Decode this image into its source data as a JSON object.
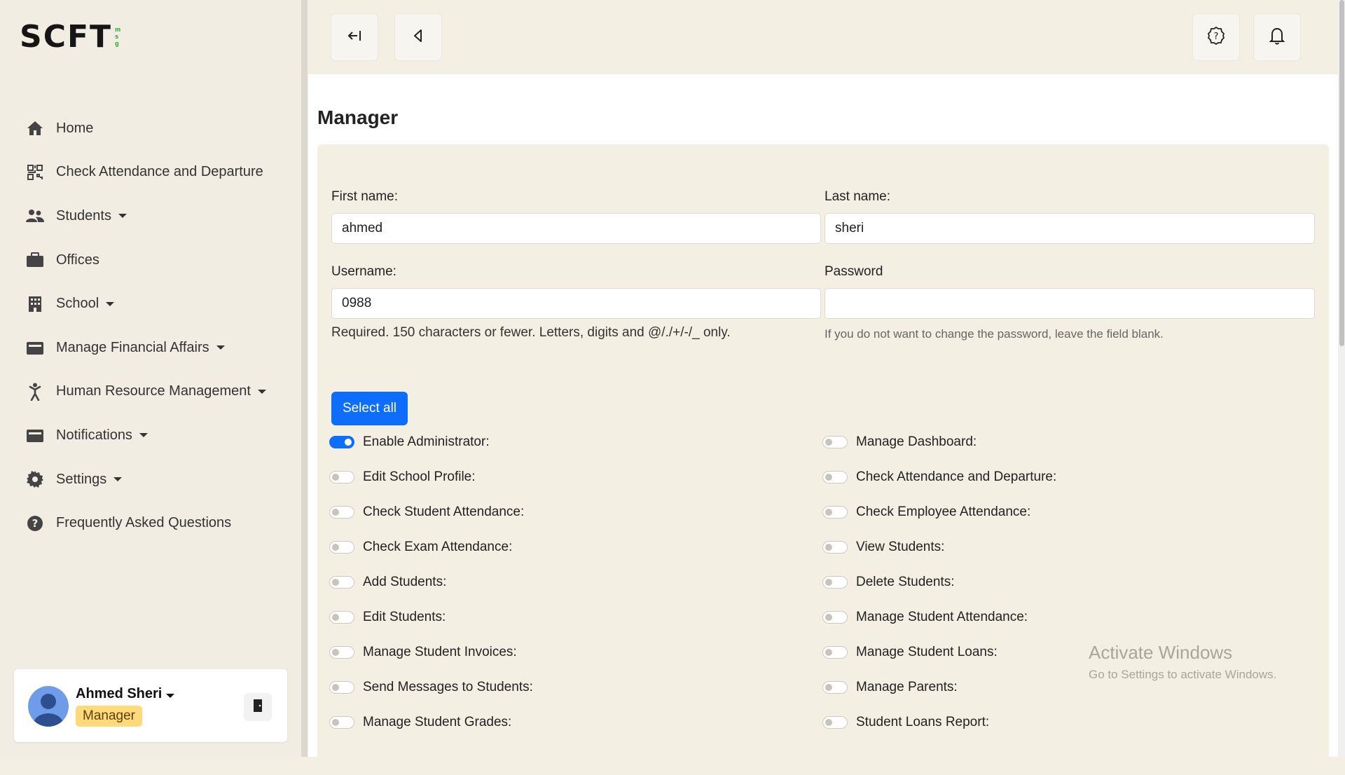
{
  "brand": {
    "logo_text": "SCFT",
    "logo_sub": [
      "m",
      "s",
      "g"
    ]
  },
  "sidebar": {
    "items": [
      {
        "label": "Home",
        "icon": "home-icon",
        "dropdown": false
      },
      {
        "label": "Check Attendance and Departure",
        "icon": "qr-code-icon",
        "dropdown": false
      },
      {
        "label": "Students",
        "icon": "users-icon",
        "dropdown": true
      },
      {
        "label": "Offices",
        "icon": "briefcase-icon",
        "dropdown": false
      },
      {
        "label": "School",
        "icon": "building-icon",
        "dropdown": true
      },
      {
        "label": "Manage Financial Affairs",
        "icon": "wallet-icon",
        "dropdown": true
      },
      {
        "label": "Human Resource Management",
        "icon": "person-icon",
        "dropdown": true
      },
      {
        "label": "Notifications",
        "icon": "inbox-icon",
        "dropdown": true
      },
      {
        "label": "Settings",
        "icon": "gear-icon",
        "dropdown": true
      },
      {
        "label": "Frequently Asked Questions",
        "icon": "question-circle-icon",
        "dropdown": false
      }
    ]
  },
  "user": {
    "name": "Ahmed Sheri",
    "role": "Manager"
  },
  "topbar": {
    "buttons": [
      "collapse-sidebar-icon",
      "back-icon",
      "help-icon",
      "bell-icon"
    ]
  },
  "page": {
    "title": "Manager"
  },
  "form": {
    "first_name_label": "First name:",
    "first_name_value": "ahmed",
    "last_name_label": "Last name:",
    "last_name_value": "sheri",
    "username_label": "Username:",
    "username_value": "0988",
    "username_help": "Required. 150 characters or fewer. Letters, digits and @/./+/-/_ only.",
    "password_label": "Password",
    "password_value": "",
    "password_help": "If you do not want to change the password, leave the field blank.",
    "select_all_label": "Select all"
  },
  "permissions_left": [
    {
      "label": "Enable Administrator:",
      "on": true
    },
    {
      "label": "Edit School Profile:",
      "on": false
    },
    {
      "label": "Check Student Attendance:",
      "on": false
    },
    {
      "label": "Check Exam Attendance:",
      "on": false
    },
    {
      "label": "Add Students:",
      "on": false
    },
    {
      "label": "Edit Students:",
      "on": false
    },
    {
      "label": "Manage Student Invoices:",
      "on": false
    },
    {
      "label": "Send Messages to Students:",
      "on": false
    },
    {
      "label": "Manage Student Grades:",
      "on": false
    }
  ],
  "permissions_right": [
    {
      "label": "Manage Dashboard:",
      "on": false
    },
    {
      "label": "Check Attendance and Departure:",
      "on": false
    },
    {
      "label": "Check Employee Attendance:",
      "on": false
    },
    {
      "label": "View Students:",
      "on": false
    },
    {
      "label": "Delete Students:",
      "on": false
    },
    {
      "label": "Manage Student Attendance:",
      "on": false
    },
    {
      "label": "Manage Student Loans:",
      "on": false
    },
    {
      "label": "Manage Parents:",
      "on": false
    },
    {
      "label": "Student Loans Report:",
      "on": false
    }
  ],
  "watermark": {
    "line1": "Activate Windows",
    "line2": "Go to Settings to activate Windows."
  },
  "colors": {
    "primary": "#0d6efd",
    "badge": "#ffd97a",
    "panel": "#f3efe3"
  }
}
